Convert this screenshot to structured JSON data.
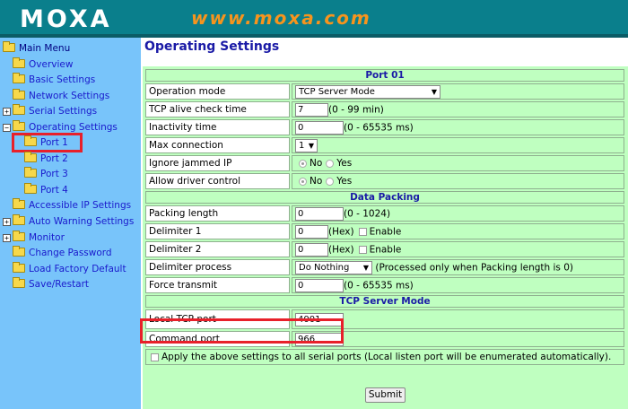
{
  "header": {
    "logo": "MOXA",
    "tagline": "www.moxa.com"
  },
  "sidebar": {
    "root": "Main Menu",
    "items": [
      "Overview",
      "Basic Settings",
      "Network Settings",
      "Serial Settings",
      "Operating Settings",
      "Port 1",
      "Port 2",
      "Port 3",
      "Port 4",
      "Accessible IP Settings",
      "Auto Warning Settings",
      "Monitor",
      "Change Password",
      "Load Factory Default",
      "Save/Restart"
    ]
  },
  "page": {
    "title": "Operating Settings"
  },
  "form": {
    "section_port": "Port 01",
    "operation_mode": {
      "label": "Operation mode",
      "value": "TCP Server Mode"
    },
    "tcp_alive": {
      "label": "TCP alive check time",
      "value": "7",
      "note": "(0 - 99 min)"
    },
    "inactivity": {
      "label": "Inactivity time",
      "value": "0",
      "note": "(0 - 65535 ms)"
    },
    "max_connection": {
      "label": "Max connection",
      "value": "1"
    },
    "ignore_jammed": {
      "label": "Ignore jammed IP",
      "no": "No",
      "yes": "Yes"
    },
    "allow_driver": {
      "label": "Allow driver control",
      "no": "No",
      "yes": "Yes"
    },
    "section_packing": "Data Packing",
    "packing_length": {
      "label": "Packing length",
      "value": "0",
      "note": "(0 - 1024)"
    },
    "delimiter1": {
      "label": "Delimiter 1",
      "value": "0",
      "hex": "(Hex)",
      "enable": "Enable"
    },
    "delimiter2": {
      "label": "Delimiter 2",
      "value": "0",
      "hex": "(Hex)",
      "enable": "Enable"
    },
    "delimiter_process": {
      "label": "Delimiter process",
      "value": "Do Nothing",
      "note": "(Processed only when Packing length is 0)"
    },
    "force_transmit": {
      "label": "Force transmit",
      "value": "0",
      "note": "(0 - 65535 ms)"
    },
    "section_tcp": "TCP Server Mode",
    "local_tcp_port": {
      "label": "Local TCP port",
      "value": "4001"
    },
    "command_port": {
      "label": "Command port",
      "value": "966"
    },
    "apply_all": "Apply the above settings to all serial ports (Local listen port will be enumerated automatically)."
  },
  "submit": "Submit",
  "colors": {
    "header": "#0a7f8c",
    "sidebar": "#78c4fa",
    "panel": "#bfffc0",
    "highlight": "#e8202a",
    "tagline": "#f7941d"
  }
}
